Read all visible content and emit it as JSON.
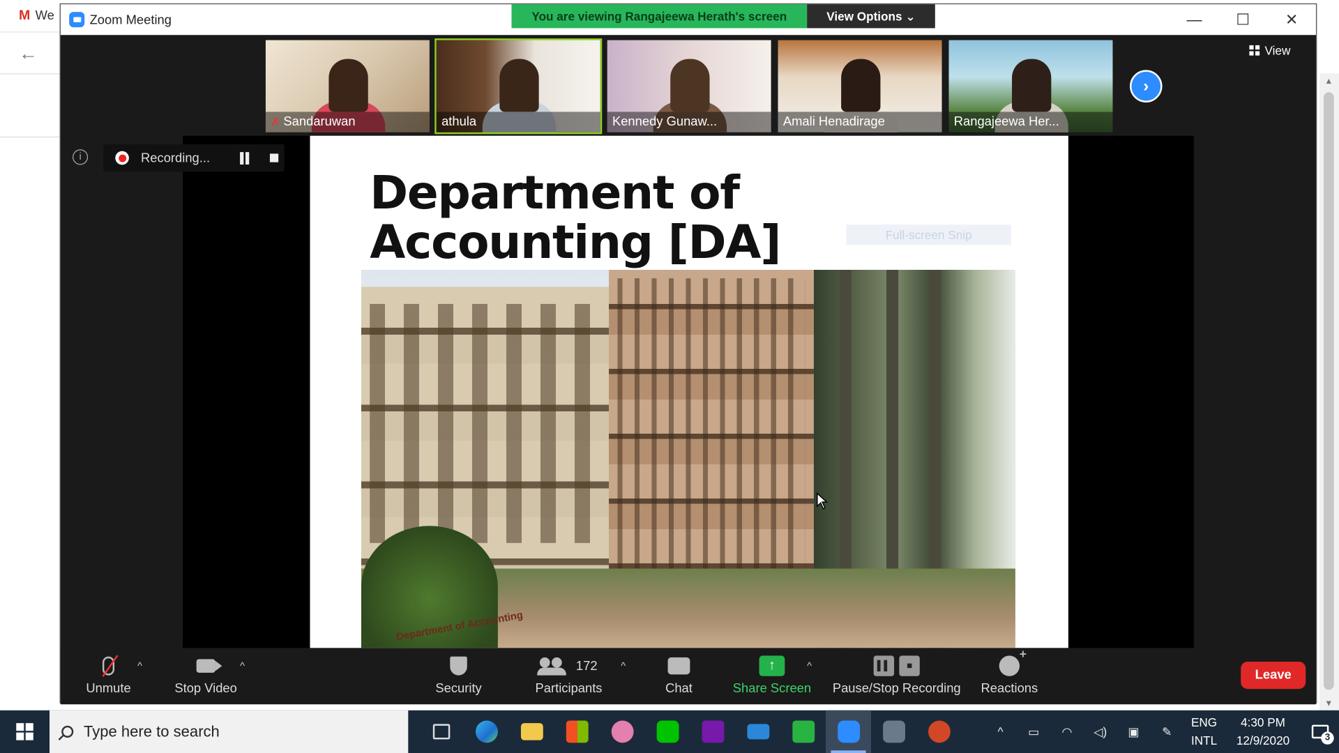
{
  "background_browser": {
    "tab_text": "We"
  },
  "zoom": {
    "window_title": "Zoom Meeting",
    "banner": {
      "message": "You are viewing Rangajeewa Herath's screen",
      "view_options": "View Options ⌄"
    },
    "view_button": "View",
    "participants_strip": [
      {
        "name": "Sandaruwan",
        "muted": true
      },
      {
        "name": "athula",
        "muted": false,
        "active_speaker": true
      },
      {
        "name": "Kennedy Gunaw...",
        "muted": false
      },
      {
        "name": "Amali Henadirage",
        "muted": false
      },
      {
        "name": "Rangajeewa Her...",
        "muted": false
      }
    ],
    "recording": {
      "status": "Recording..."
    },
    "slide": {
      "title": "Department of Accounting [DA]",
      "snip_label": "Full-screen Snip",
      "sign_text": "Department of Accounting"
    },
    "toolbar": {
      "unmute": "Unmute",
      "stop_video": "Stop Video",
      "security": "Security",
      "participants": "Participants",
      "participants_count": "172",
      "chat": "Chat",
      "share_screen": "Share Screen",
      "pause_stop_recording": "Pause/Stop Recording",
      "reactions": "Reactions",
      "leave": "Leave"
    }
  },
  "taskbar": {
    "search_placeholder": "Type here to search",
    "language": "ENG",
    "keyboard": "INTL",
    "time": "4:30 PM",
    "date": "12/9/2020",
    "notifications_count": "3",
    "apps": [
      "task-view",
      "edge",
      "file-explorer",
      "store",
      "snip-sketch",
      "line",
      "onenote",
      "mail",
      "camtasia",
      "zoom",
      "camera",
      "powerpoint"
    ]
  },
  "colors": {
    "zoom_blue": "#2d8cff",
    "banner_green": "#27b75a",
    "leave_red": "#e02828",
    "share_green": "#24b24b",
    "active_tile_border": "#8fd11f"
  }
}
